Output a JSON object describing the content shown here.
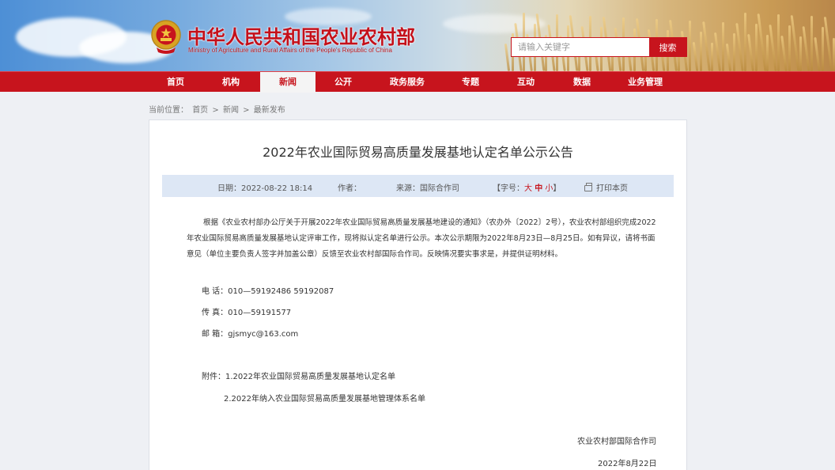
{
  "header": {
    "site_title": "中华人民共和国农业农村部",
    "site_subtitle": "Ministry of Agriculture and Rural Affairs of the People's Republic of China",
    "search_placeholder": "请输入关键字",
    "search_button": "搜索"
  },
  "nav": {
    "items": [
      {
        "label": "首页"
      },
      {
        "label": "机构"
      },
      {
        "label": "新闻"
      },
      {
        "label": "公开"
      },
      {
        "label": "政务服务"
      },
      {
        "label": "专题"
      },
      {
        "label": "互动"
      },
      {
        "label": "数据"
      },
      {
        "label": "业务管理"
      }
    ],
    "active": "新闻"
  },
  "breadcrumb": {
    "prefix": "当前位置：",
    "items": [
      "首页",
      "新闻",
      "最新发布"
    ],
    "separator": ">"
  },
  "article": {
    "title": "2022年农业国际贸易高质量发展基地认定名单公示公告",
    "meta": {
      "date": "日期：2022-08-22 18:14",
      "author": "作者：",
      "source": "来源：国际合作司",
      "font_size_label": "【字号：",
      "font_big": "大",
      "font_mid": "中",
      "font_small": "小",
      "font_close": "】",
      "print": "打印本页"
    },
    "body": "根据《农业农村部办公厅关于开展2022年农业国际贸易高质量发展基地建设的通知》（农办外〔2022〕2号），农业农村部组织完成2022年农业国际贸易高质量发展基地认定评审工作，现将拟认定名单进行公示。本次公示期限为2022年8月23日—8月25日。如有异议，请将书面意见（单位主要负责人签字并加盖公章）反馈至农业农村部国际合作司。反映情况要实事求是，并提供证明材料。",
    "phone": "电 话：010—59192486  59192087",
    "fax": "传 真：010—59191577",
    "email": "邮 箱：gjsmyc@163.com",
    "attachment1": "附件：1.2022年农业国际贸易高质量发展基地认定名单",
    "attachment2": "2.2022年纳入农业国际贸易高质量发展基地管理体系名单",
    "signer": "农业农村部国际合作司",
    "sign_date": "2022年8月22日"
  },
  "colors": {
    "brand_red": "#c7141d",
    "meta_bar_bg": "#dde7f5"
  }
}
